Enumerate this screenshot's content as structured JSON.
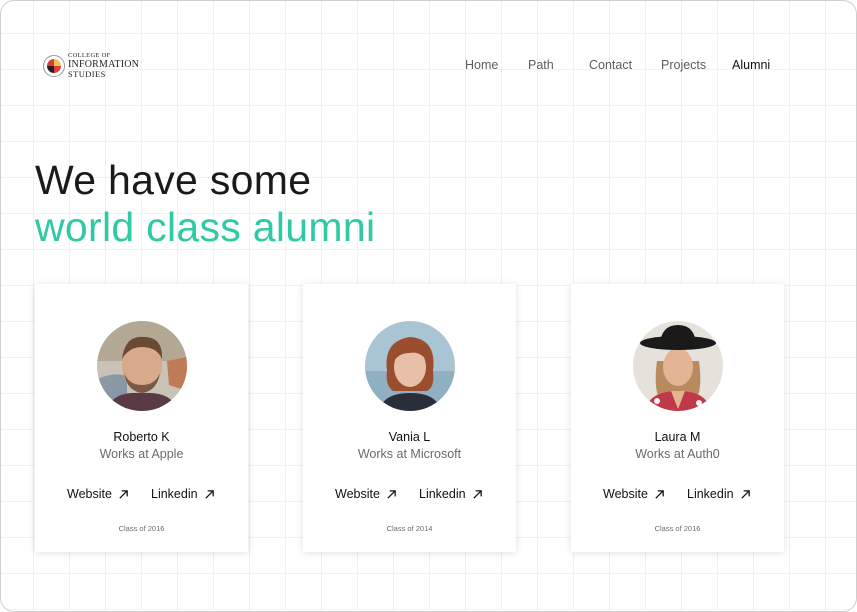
{
  "logo": {
    "line1": "COLLEGE OF",
    "line2": "INFORMATION",
    "line3": "STUDIES",
    "icon": "university-seal-icon"
  },
  "nav": {
    "items": [
      "Home",
      "Path",
      "Contact",
      "Projects",
      "Alumni"
    ],
    "active": "Alumni"
  },
  "hero": {
    "line1": "We have some",
    "line2": "world class alumni"
  },
  "colors": {
    "accent": "#2fcaa3",
    "text": "#111111",
    "muted": "#6a6a6a"
  },
  "alumni": [
    {
      "name": "Roberto K",
      "role": "Works at Apple",
      "website_label": "Website",
      "linkedin_label": "Linkedin",
      "class_year": "Class of 2016",
      "link_icon": "arrow-up-right-icon"
    },
    {
      "name": "Vania L",
      "role": "Works at Microsoft",
      "website_label": "Website",
      "linkedin_label": "Linkedin",
      "class_year": "Class of 2014",
      "link_icon": "arrow-up-right-icon"
    },
    {
      "name": "Laura M",
      "role": "Works at Auth0",
      "website_label": "Website",
      "linkedin_label": "Linkedin",
      "class_year": "Class of 2016",
      "link_icon": "arrow-up-right-icon"
    }
  ]
}
